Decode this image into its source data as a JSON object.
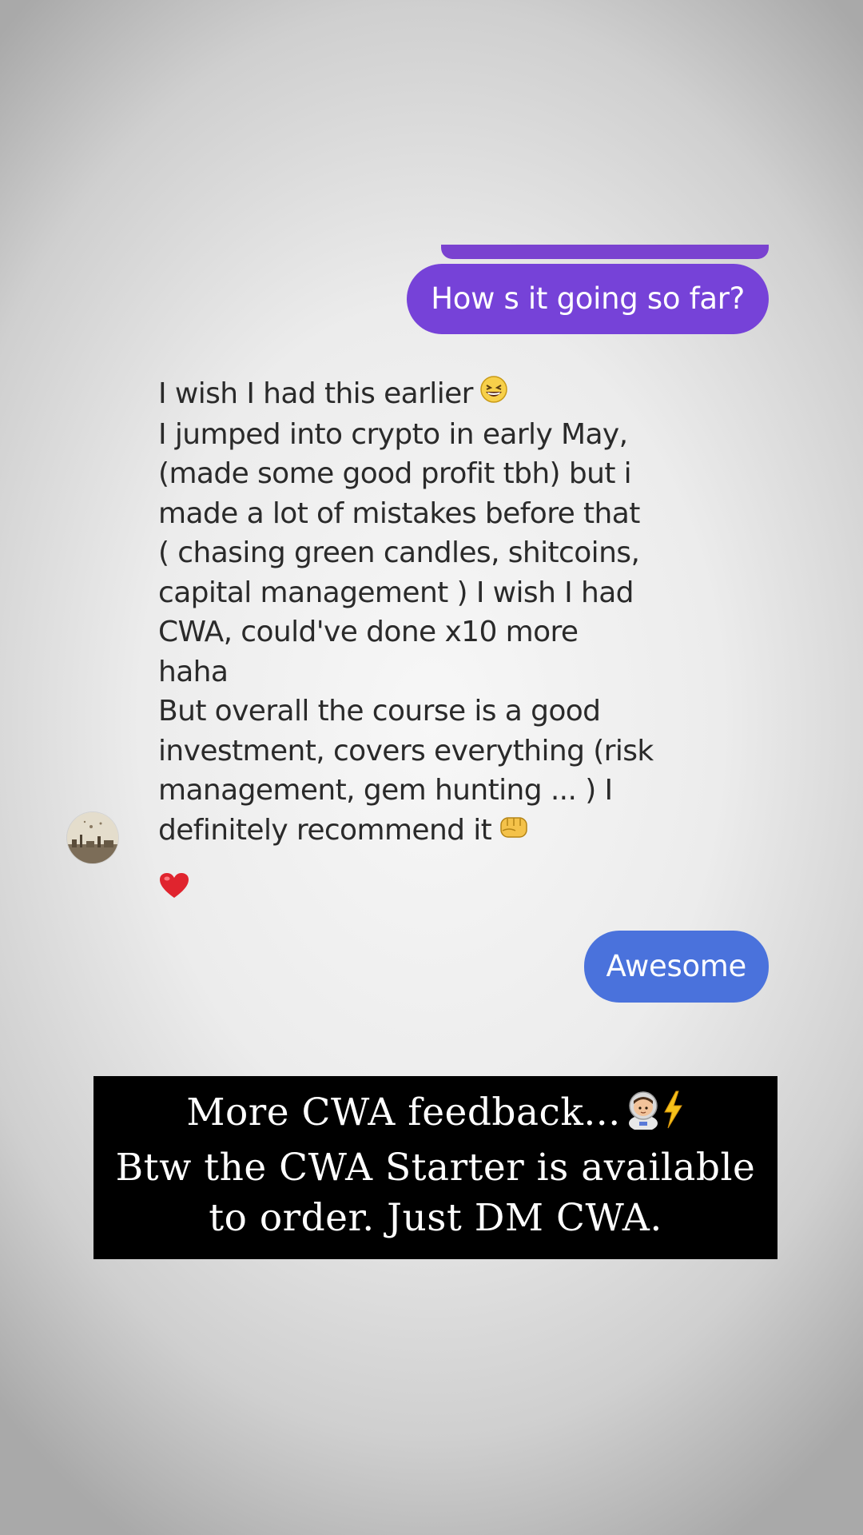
{
  "conversation": {
    "previous_bubble_color": "#7a42d0",
    "messages": [
      {
        "direction": "sent",
        "text": "How s it going so far?",
        "bubble_color": "#7642d8"
      },
      {
        "direction": "received",
        "lines": [
          "I wish I had this earlier",
          "I jumped into crypto in early May,",
          "(made some good profit tbh) but i",
          "made a lot of mistakes before that",
          "( chasing green candles, shitcoins,",
          "capital management ) I wish I had",
          "CWA, could've done x10 more",
          "haha",
          "But overall the course is a good",
          "investment, covers everything (risk",
          "management, gem hunting ... ) I",
          "definitely recommend it"
        ],
        "emojis": [
          "grinning-squinting-face-emoji",
          "fist-bump-emoji"
        ],
        "reaction": "red-heart-emoji",
        "sender_avatar": "avatar"
      },
      {
        "direction": "sent",
        "text": "Awesome",
        "bubble_color": "#4a72dc"
      }
    ]
  },
  "caption": {
    "line1": "More CWA feedback...",
    "line2": "Btw the CWA Starter is available",
    "line3": "to order. Just DM CWA.",
    "icons": [
      "astronaut-emoji",
      "lightning-emoji"
    ],
    "background": "#000000",
    "text_color": "#ffffff"
  }
}
